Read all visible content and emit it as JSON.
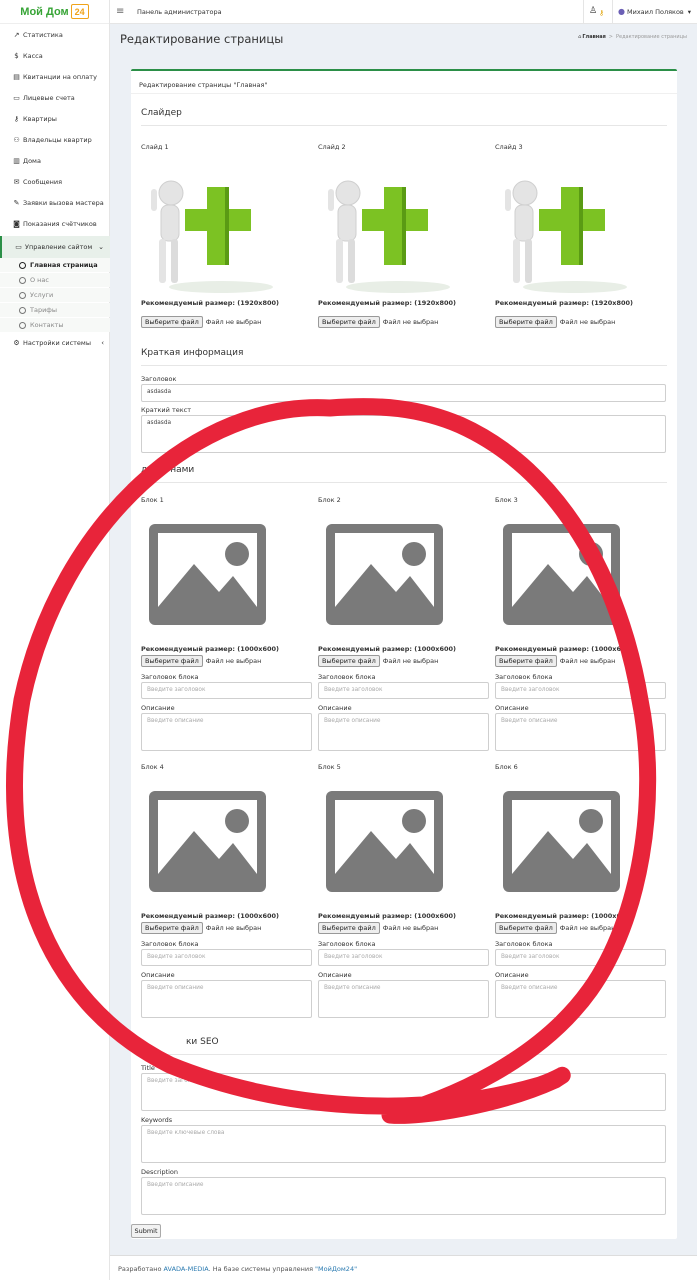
{
  "logo": {
    "text": "Мой Дом",
    "badge": "24"
  },
  "sidebar": {
    "items": [
      {
        "icon": "chart-icon",
        "glyph": "↗",
        "label": "Статистика"
      },
      {
        "icon": "dollar-icon",
        "glyph": "$",
        "label": "Касса"
      },
      {
        "icon": "receipt-icon",
        "glyph": "▤",
        "label": "Квитанции на оплату"
      },
      {
        "icon": "card-icon",
        "glyph": "▭",
        "label": "Лицевые счета"
      },
      {
        "icon": "key-icon",
        "glyph": "⚷",
        "label": "Квартиры"
      },
      {
        "icon": "users-icon",
        "glyph": "⚇",
        "label": "Владельцы квартир"
      },
      {
        "icon": "building-icon",
        "glyph": "▥",
        "label": "Дома"
      },
      {
        "icon": "envelope-icon",
        "glyph": "✉",
        "label": "Сообщения"
      },
      {
        "icon": "wrench-icon",
        "glyph": "✎",
        "label": "Заявки вызова мастера"
      },
      {
        "icon": "meter-icon",
        "glyph": "◙",
        "label": "Показания счётчиков"
      },
      {
        "icon": "desktop-icon",
        "glyph": "▭",
        "label": "Управление сайтом"
      }
    ],
    "sub_items": [
      {
        "label": "Главная страница",
        "active": true
      },
      {
        "label": "О нас"
      },
      {
        "label": "Услуги"
      },
      {
        "label": "Тарифы"
      },
      {
        "label": "Контакты"
      }
    ],
    "settings": {
      "icon": "gears-icon",
      "glyph": "⚙",
      "label": "Настройки системы"
    }
  },
  "topbar": {
    "title": "Панель администратора",
    "user": "Михаил Поляков"
  },
  "page": {
    "title": "Редактирование страницы"
  },
  "breadcrumb": {
    "home": "Главная",
    "separator": ">",
    "current": "Редактирование страницы"
  },
  "card": {
    "title": "Редактирование страницы \"Главная\""
  },
  "slider": {
    "title": "Слайдер",
    "slides": [
      {
        "label": "Слайд 1"
      },
      {
        "label": "Слайд 2"
      },
      {
        "label": "Слайд 3"
      }
    ],
    "recommended": "Рекомендуемый размер: (1920x800)"
  },
  "file": {
    "button": "Выберите файл",
    "status": "Файл не выбран"
  },
  "info": {
    "title": "Краткая информация",
    "heading_label": "Заголовок",
    "heading_value": "asdasda",
    "text_label": "Краткий текст",
    "text_value": "asdasda"
  },
  "near": {
    "title": "Рядом с нами",
    "title_visible": "дом с нами",
    "blocks": [
      {
        "label": "Блок 1"
      },
      {
        "label": "Блок 2"
      },
      {
        "label": "Блок 3"
      },
      {
        "label": "Блок 4"
      },
      {
        "label": "Блок 5"
      },
      {
        "label": "Блок 6"
      }
    ],
    "recommended": "Рекомендуемый размер: (1000x600)",
    "heading_label": "Заголовок блока",
    "heading_placeholder": "Введите заголовок",
    "desc_label": "Описание",
    "desc_placeholder": "Введите описание"
  },
  "seo": {
    "title_visible": "ки SEO",
    "title_label": "Title",
    "title_placeholder": "Введите заголовок",
    "keywords_label": "Keywords",
    "keywords_placeholder": "Введите ключевые слова",
    "desc_label": "Description",
    "desc_placeholder": "Введите описание"
  },
  "submit_label": "Submit",
  "footer": {
    "prefix": "Разработано ",
    "link1": "AVADA-MEDIA",
    "middle": ". На базе системы управления ",
    "link2": "\"МойДом24\""
  },
  "colors": {
    "brand_green": "#37a436",
    "accent": "#2b8f47",
    "annotation_red": "#e8243a",
    "link": "#2a7ab0"
  }
}
